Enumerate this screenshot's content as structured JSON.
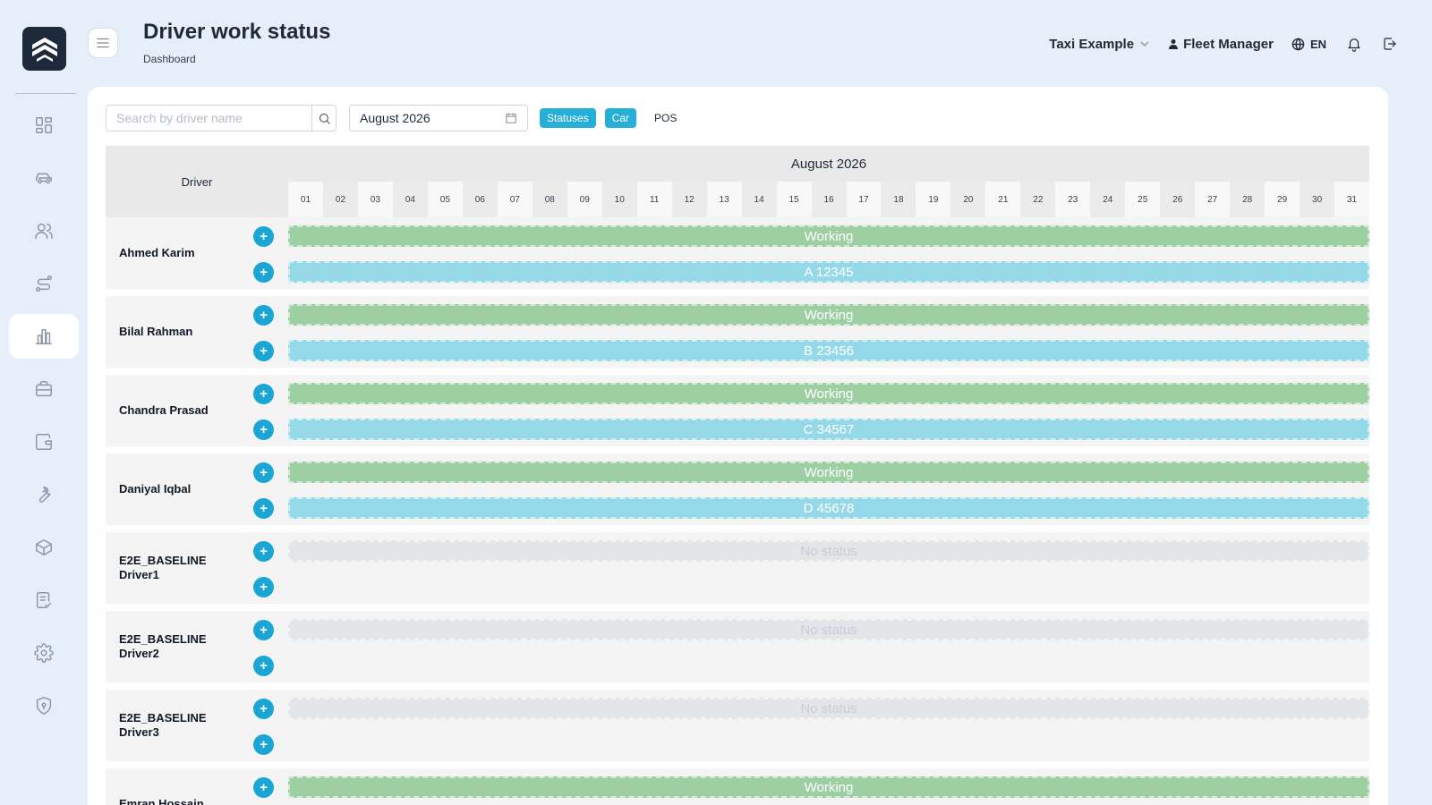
{
  "header": {
    "title": "Driver work status",
    "breadcrumb": "Dashboard",
    "company": "Taxi Example",
    "user": "Fleet Manager",
    "language": "EN"
  },
  "sidebar": {
    "items": [
      {
        "icon": "dashboard-icon",
        "active": false
      },
      {
        "icon": "car-icon",
        "active": false
      },
      {
        "icon": "users-icon",
        "active": false
      },
      {
        "icon": "route-icon",
        "active": false
      },
      {
        "icon": "bar-chart-icon",
        "active": true
      },
      {
        "icon": "briefcase-icon",
        "active": false
      },
      {
        "icon": "wallet-icon",
        "active": false
      },
      {
        "icon": "wrench-icon",
        "active": false
      },
      {
        "icon": "box-icon",
        "active": false
      },
      {
        "icon": "checklist-icon",
        "active": false
      },
      {
        "icon": "gear-icon",
        "active": false
      },
      {
        "icon": "shield-icon",
        "active": false
      }
    ]
  },
  "toolbar": {
    "search_placeholder": "Search by driver name",
    "search_value": "",
    "month": "August 2026",
    "chips": [
      {
        "label": "Statuses",
        "active": true
      },
      {
        "label": "Car",
        "active": true
      },
      {
        "label": "POS",
        "active": false
      }
    ]
  },
  "grid": {
    "driver_header": "Driver",
    "month_header": "August 2026",
    "days": [
      "01",
      "02",
      "03",
      "04",
      "05",
      "06",
      "07",
      "08",
      "09",
      "10",
      "11",
      "12",
      "13",
      "14",
      "15",
      "16",
      "17",
      "18",
      "19",
      "20",
      "21",
      "22",
      "23",
      "24",
      "25",
      "26",
      "27",
      "28",
      "29",
      "30",
      "31"
    ],
    "rows": [
      {
        "name": "Ahmed Karim",
        "status": "Working",
        "car": "A 12345"
      },
      {
        "name": "Bilal Rahman",
        "status": "Working",
        "car": "B 23456"
      },
      {
        "name": "Chandra Prasad",
        "status": "Working",
        "car": "C 34567"
      },
      {
        "name": "Daniyal Iqbal",
        "status": "Working",
        "car": "D 45678"
      },
      {
        "name": "E2E_BASELINE Driver1",
        "status": "No status",
        "car": ""
      },
      {
        "name": "E2E_BASELINE Driver2",
        "status": "No status",
        "car": ""
      },
      {
        "name": "E2E_BASELINE Driver3",
        "status": "No status",
        "car": ""
      },
      {
        "name": "Emran Hossain",
        "status": "Working",
        "car": ""
      }
    ]
  },
  "colors": {
    "accent": "#26b0d8",
    "working": "#9dcfa3",
    "car": "#95d9e8",
    "no_status": "#e3e6e9"
  }
}
